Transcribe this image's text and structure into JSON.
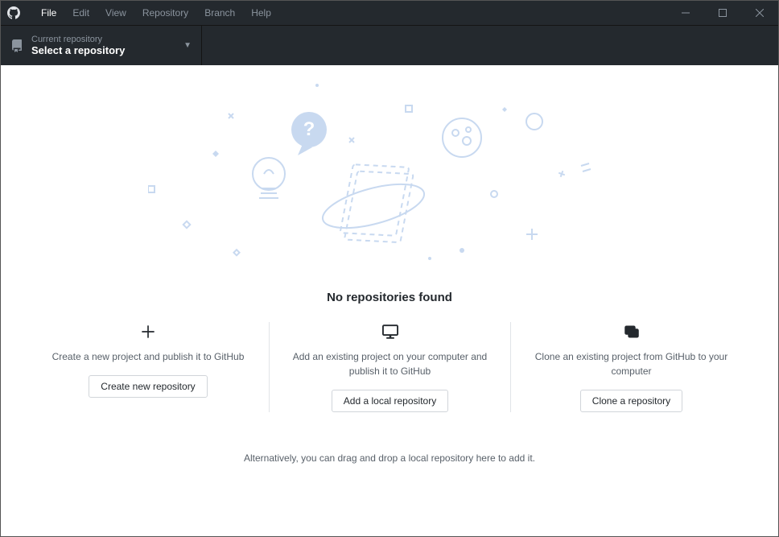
{
  "menubar": {
    "items": [
      "File",
      "Edit",
      "View",
      "Repository",
      "Branch",
      "Help"
    ],
    "active_index": 0
  },
  "toolbar": {
    "repo_selector": {
      "label": "Current repository",
      "value": "Select a repository"
    }
  },
  "main": {
    "heading": "No repositories found",
    "options": [
      {
        "icon": "plus-icon",
        "description": "Create a new project and publish it to GitHub",
        "button_label": "Create new repository"
      },
      {
        "icon": "monitor-icon",
        "description": "Add an existing project on your computer and publish it to GitHub",
        "button_label": "Add a local repository"
      },
      {
        "icon": "clone-icon",
        "description": "Clone an existing project from GitHub to your computer",
        "button_label": "Clone a repository"
      }
    ],
    "footnote": "Alternatively, you can drag and drop a local repository here to add it."
  }
}
